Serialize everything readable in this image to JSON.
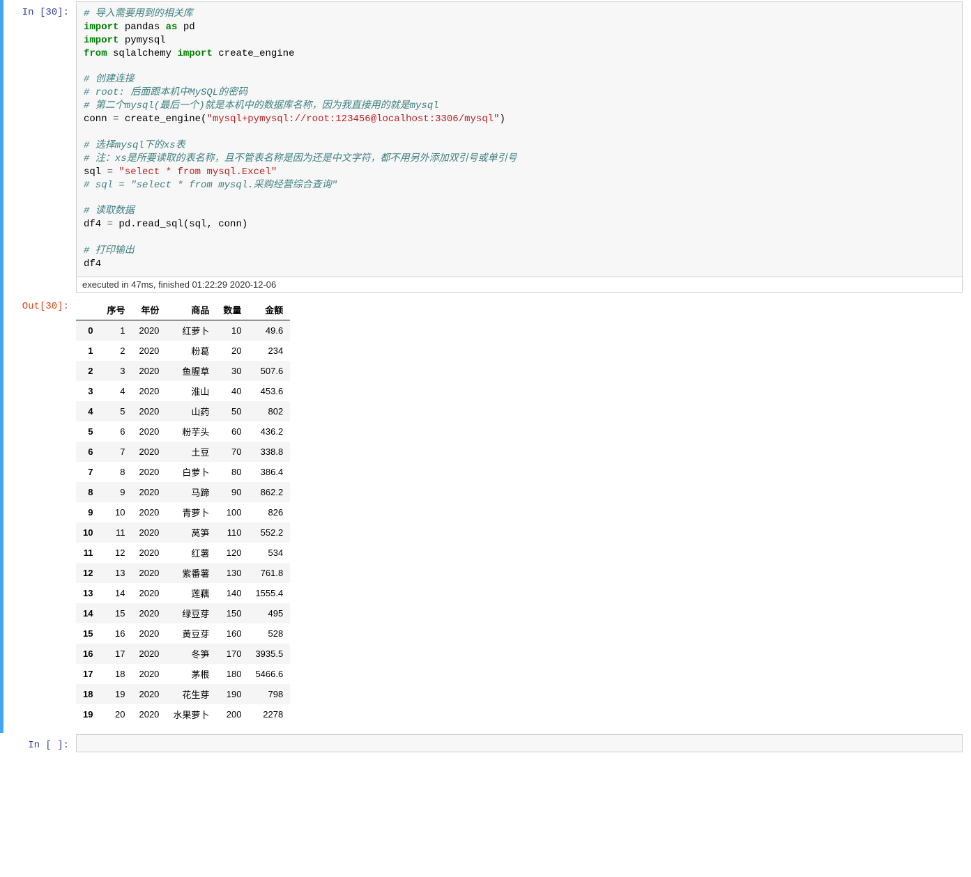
{
  "exec_count": "30",
  "prompts": {
    "in": "In  [30]:",
    "out": "Out[30]:",
    "in_empty": "In  [  ]:"
  },
  "code": {
    "l1": "# 导入需要用到的相关库",
    "l2a": "import",
    "l2b": " pandas ",
    "l2c": "as",
    "l2d": " pd",
    "l3a": "import",
    "l3b": " pymysql",
    "l4a": "from",
    "l4b": " sqlalchemy ",
    "l4c": "import",
    "l4d": " create_engine",
    "l6": "# 创建连接",
    "l7": "# root: 后面跟本机中MySQL的密码",
    "l8": "# 第二个mysql(最后一个)就是本机中的数据库名称，因为我直接用的就是mysql",
    "l9a": "conn ",
    "l9b": "=",
    "l9c": " create_engine(",
    "l9d": "\"mysql+pymysql://root:123456@localhost:3306/mysql\"",
    "l9e": ")",
    "l11": "# 选择mysql下的xs表",
    "l12": "# 注：xs是所要读取的表名称，且不管表名称是因为还是中文字符，都不用另外添加双引号或单引号",
    "l13a": "sql ",
    "l13b": "=",
    "l13c": " ",
    "l13d": "\"select * from mysql.Excel\"",
    "l14": "# sql = \"select * from mysql.采购经营综合查询\"",
    "l16": "# 读取数据",
    "l17a": "df4 ",
    "l17b": "=",
    "l17c": " pd.read_sql(sql, conn)",
    "l19": "# 打印输出",
    "l20": "df4"
  },
  "timing": "executed in 47ms, finished 01:22:29 2020-12-06",
  "table": {
    "columns": [
      "",
      "序号",
      "年份",
      "商品",
      "数量",
      "金额"
    ],
    "rows": [
      [
        "0",
        "1",
        "2020",
        "红萝卜",
        "10",
        "49.6"
      ],
      [
        "1",
        "2",
        "2020",
        "粉葛",
        "20",
        "234"
      ],
      [
        "2",
        "3",
        "2020",
        "鱼腥草",
        "30",
        "507.6"
      ],
      [
        "3",
        "4",
        "2020",
        "淮山",
        "40",
        "453.6"
      ],
      [
        "4",
        "5",
        "2020",
        "山药",
        "50",
        "802"
      ],
      [
        "5",
        "6",
        "2020",
        "粉芋头",
        "60",
        "436.2"
      ],
      [
        "6",
        "7",
        "2020",
        "土豆",
        "70",
        "338.8"
      ],
      [
        "7",
        "8",
        "2020",
        "白萝卜",
        "80",
        "386.4"
      ],
      [
        "8",
        "9",
        "2020",
        "马蹄",
        "90",
        "862.2"
      ],
      [
        "9",
        "10",
        "2020",
        "青萝卜",
        "100",
        "826"
      ],
      [
        "10",
        "11",
        "2020",
        "莴笋",
        "110",
        "552.2"
      ],
      [
        "11",
        "12",
        "2020",
        "红薯",
        "120",
        "534"
      ],
      [
        "12",
        "13",
        "2020",
        "紫番薯",
        "130",
        "761.8"
      ],
      [
        "13",
        "14",
        "2020",
        "莲藕",
        "140",
        "1555.4"
      ],
      [
        "14",
        "15",
        "2020",
        "绿豆芽",
        "150",
        "495"
      ],
      [
        "15",
        "16",
        "2020",
        "黄豆芽",
        "160",
        "528"
      ],
      [
        "16",
        "17",
        "2020",
        "冬笋",
        "170",
        "3935.5"
      ],
      [
        "17",
        "18",
        "2020",
        "茅根",
        "180",
        "5466.6"
      ],
      [
        "18",
        "19",
        "2020",
        "花生芽",
        "190",
        "798"
      ],
      [
        "19",
        "20",
        "2020",
        "水果萝卜",
        "200",
        "2278"
      ]
    ]
  }
}
